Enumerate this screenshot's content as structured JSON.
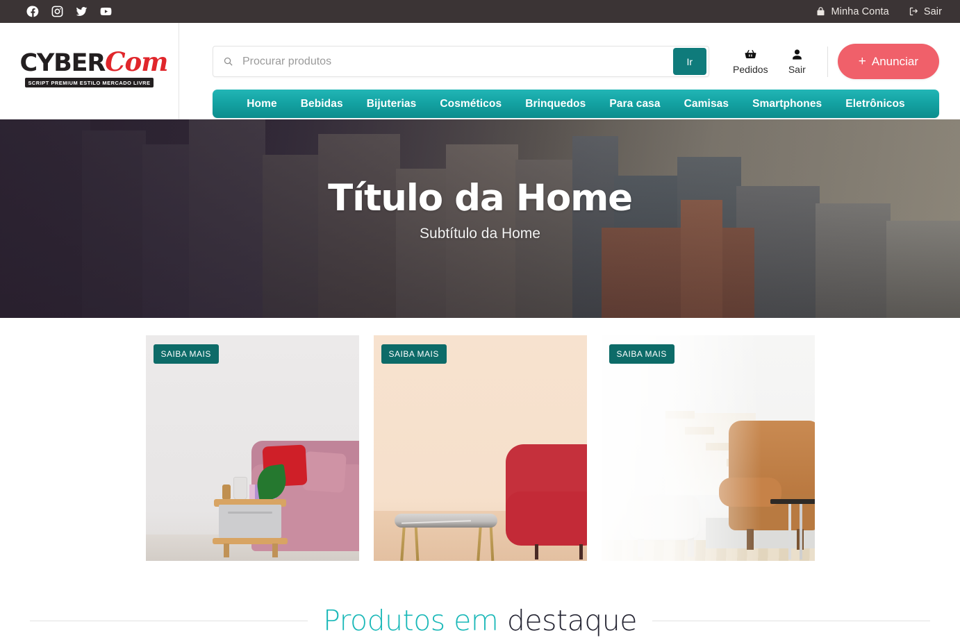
{
  "topbar": {
    "social": [
      {
        "name": "facebook-icon",
        "label": "Facebook"
      },
      {
        "name": "instagram-icon",
        "label": "Instagram"
      },
      {
        "name": "twitter-icon",
        "label": "Twitter"
      },
      {
        "name": "youtube-icon",
        "label": "YouTube"
      }
    ],
    "account_label": "Minha Conta",
    "logout_label": "Sair",
    "bg_color": "#3b3435"
  },
  "logo": {
    "primary": "CYBER",
    "secondary": "Com",
    "tagline": "SCRIPT PREMIUM ESTILO MERCADO LIVRE",
    "primary_color": "#231f20",
    "secondary_color": "#e0262b"
  },
  "search": {
    "placeholder": "Procurar produtos",
    "value": "",
    "button_label": "Ir",
    "button_color": "#0f7b7b"
  },
  "header_actions": {
    "orders_label": "Pedidos",
    "logout_label": "Sair",
    "announce_label": "Anunciar",
    "announce_plus": "+",
    "announce_color": "#f0606a"
  },
  "nav": {
    "bg_color": "#14a3a3",
    "items": [
      {
        "label": "Home"
      },
      {
        "label": "Bebidas"
      },
      {
        "label": "Bijuterias"
      },
      {
        "label": "Cosméticos"
      },
      {
        "label": "Brinquedos"
      },
      {
        "label": "Para casa"
      },
      {
        "label": "Camisas"
      },
      {
        "label": "Smartphones"
      },
      {
        "label": "Eletrônicos"
      }
    ]
  },
  "hero": {
    "title": "Título da Home",
    "subtitle": "Subtítulo da Home"
  },
  "promo_cards": [
    {
      "badge": "SAIBA MAIS",
      "scene": "living-room-pink-sofa"
    },
    {
      "badge": "SAIBA MAIS",
      "scene": "living-room-red-sofa"
    },
    {
      "badge": "SAIBA MAIS",
      "scene": "living-room-leather-chair"
    }
  ],
  "featured_section": {
    "title_accent": "Produtos em",
    "title_rest": "destaque",
    "accent_color": "#1ab8b8",
    "rest_color": "#242432"
  }
}
